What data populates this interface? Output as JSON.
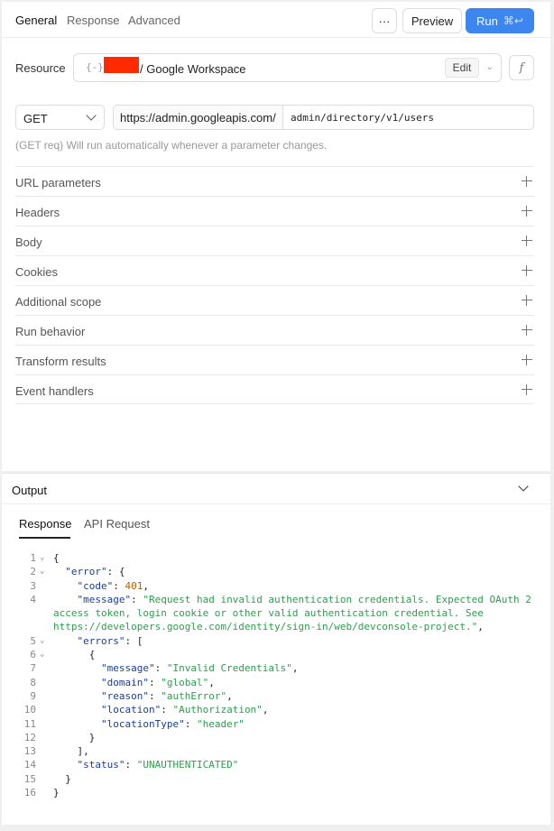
{
  "toolbar": {
    "tabs": [
      "General",
      "Response",
      "Advanced"
    ],
    "more_label": "···",
    "preview_label": "Preview",
    "run_label": "Run",
    "run_shortcut": "⌘↩"
  },
  "resource": {
    "label": "Resource",
    "icon": "{-}",
    "name": "/ Google Workspace",
    "edit_label": "Edit",
    "fx_label": "f"
  },
  "request": {
    "method": "GET",
    "base_url": "https://admin.googleapis.com/",
    "path": "admin/directory/v1/users",
    "hint": "(GET req) Will run automatically whenever a parameter changes."
  },
  "sections": [
    "URL parameters",
    "Headers",
    "Body",
    "Cookies",
    "Additional scope",
    "Run behavior",
    "Transform results",
    "Event handlers"
  ],
  "output": {
    "title": "Output",
    "tabs": [
      "Response",
      "API Request"
    ],
    "code_lines": [
      {
        "n": "1",
        "fold": true,
        "html": "{"
      },
      {
        "n": "2",
        "fold": true,
        "html": "  <span class=\"k\">\"error\"</span>: {"
      },
      {
        "n": "3",
        "fold": false,
        "html": "    <span class=\"k\">\"code\"</span>: <span class=\"n\">401</span>,"
      },
      {
        "n": "4",
        "fold": false,
        "html": "    <span class=\"k\">\"message\"</span>: <span class=\"s\">\"Request had invalid authentication credentials. Expected OAuth 2</span>"
      },
      {
        "n": "",
        "fold": false,
        "html": "<span class=\"s\">access token, login cookie or other valid authentication credential. See</span>"
      },
      {
        "n": "",
        "fold": false,
        "html": "<span class=\"s\">https://developers.google.com/identity/sign-in/web/devconsole-project.\"</span>,"
      },
      {
        "n": "5",
        "fold": true,
        "html": "    <span class=\"k\">\"errors\"</span>: ["
      },
      {
        "n": "6",
        "fold": true,
        "html": "      {"
      },
      {
        "n": "7",
        "fold": false,
        "html": "        <span class=\"k\">\"message\"</span>: <span class=\"s\">\"Invalid Credentials\"</span>,"
      },
      {
        "n": "8",
        "fold": false,
        "html": "        <span class=\"k\">\"domain\"</span>: <span class=\"s\">\"global\"</span>,"
      },
      {
        "n": "9",
        "fold": false,
        "html": "        <span class=\"k\">\"reason\"</span>: <span class=\"s\">\"authError\"</span>,"
      },
      {
        "n": "10",
        "fold": false,
        "html": "        <span class=\"k\">\"location\"</span>: <span class=\"s\">\"Authorization\"</span>,"
      },
      {
        "n": "11",
        "fold": false,
        "html": "        <span class=\"k\">\"locationType\"</span>: <span class=\"s\">\"header\"</span>"
      },
      {
        "n": "12",
        "fold": false,
        "html": "      }"
      },
      {
        "n": "13",
        "fold": false,
        "html": "    ],"
      },
      {
        "n": "14",
        "fold": false,
        "html": "    <span class=\"k\">\"status\"</span>: <span class=\"s\">\"UNAUTHENTICATED\"</span>"
      },
      {
        "n": "15",
        "fold": false,
        "html": "  }"
      },
      {
        "n": "16",
        "fold": false,
        "html": "}"
      }
    ]
  }
}
